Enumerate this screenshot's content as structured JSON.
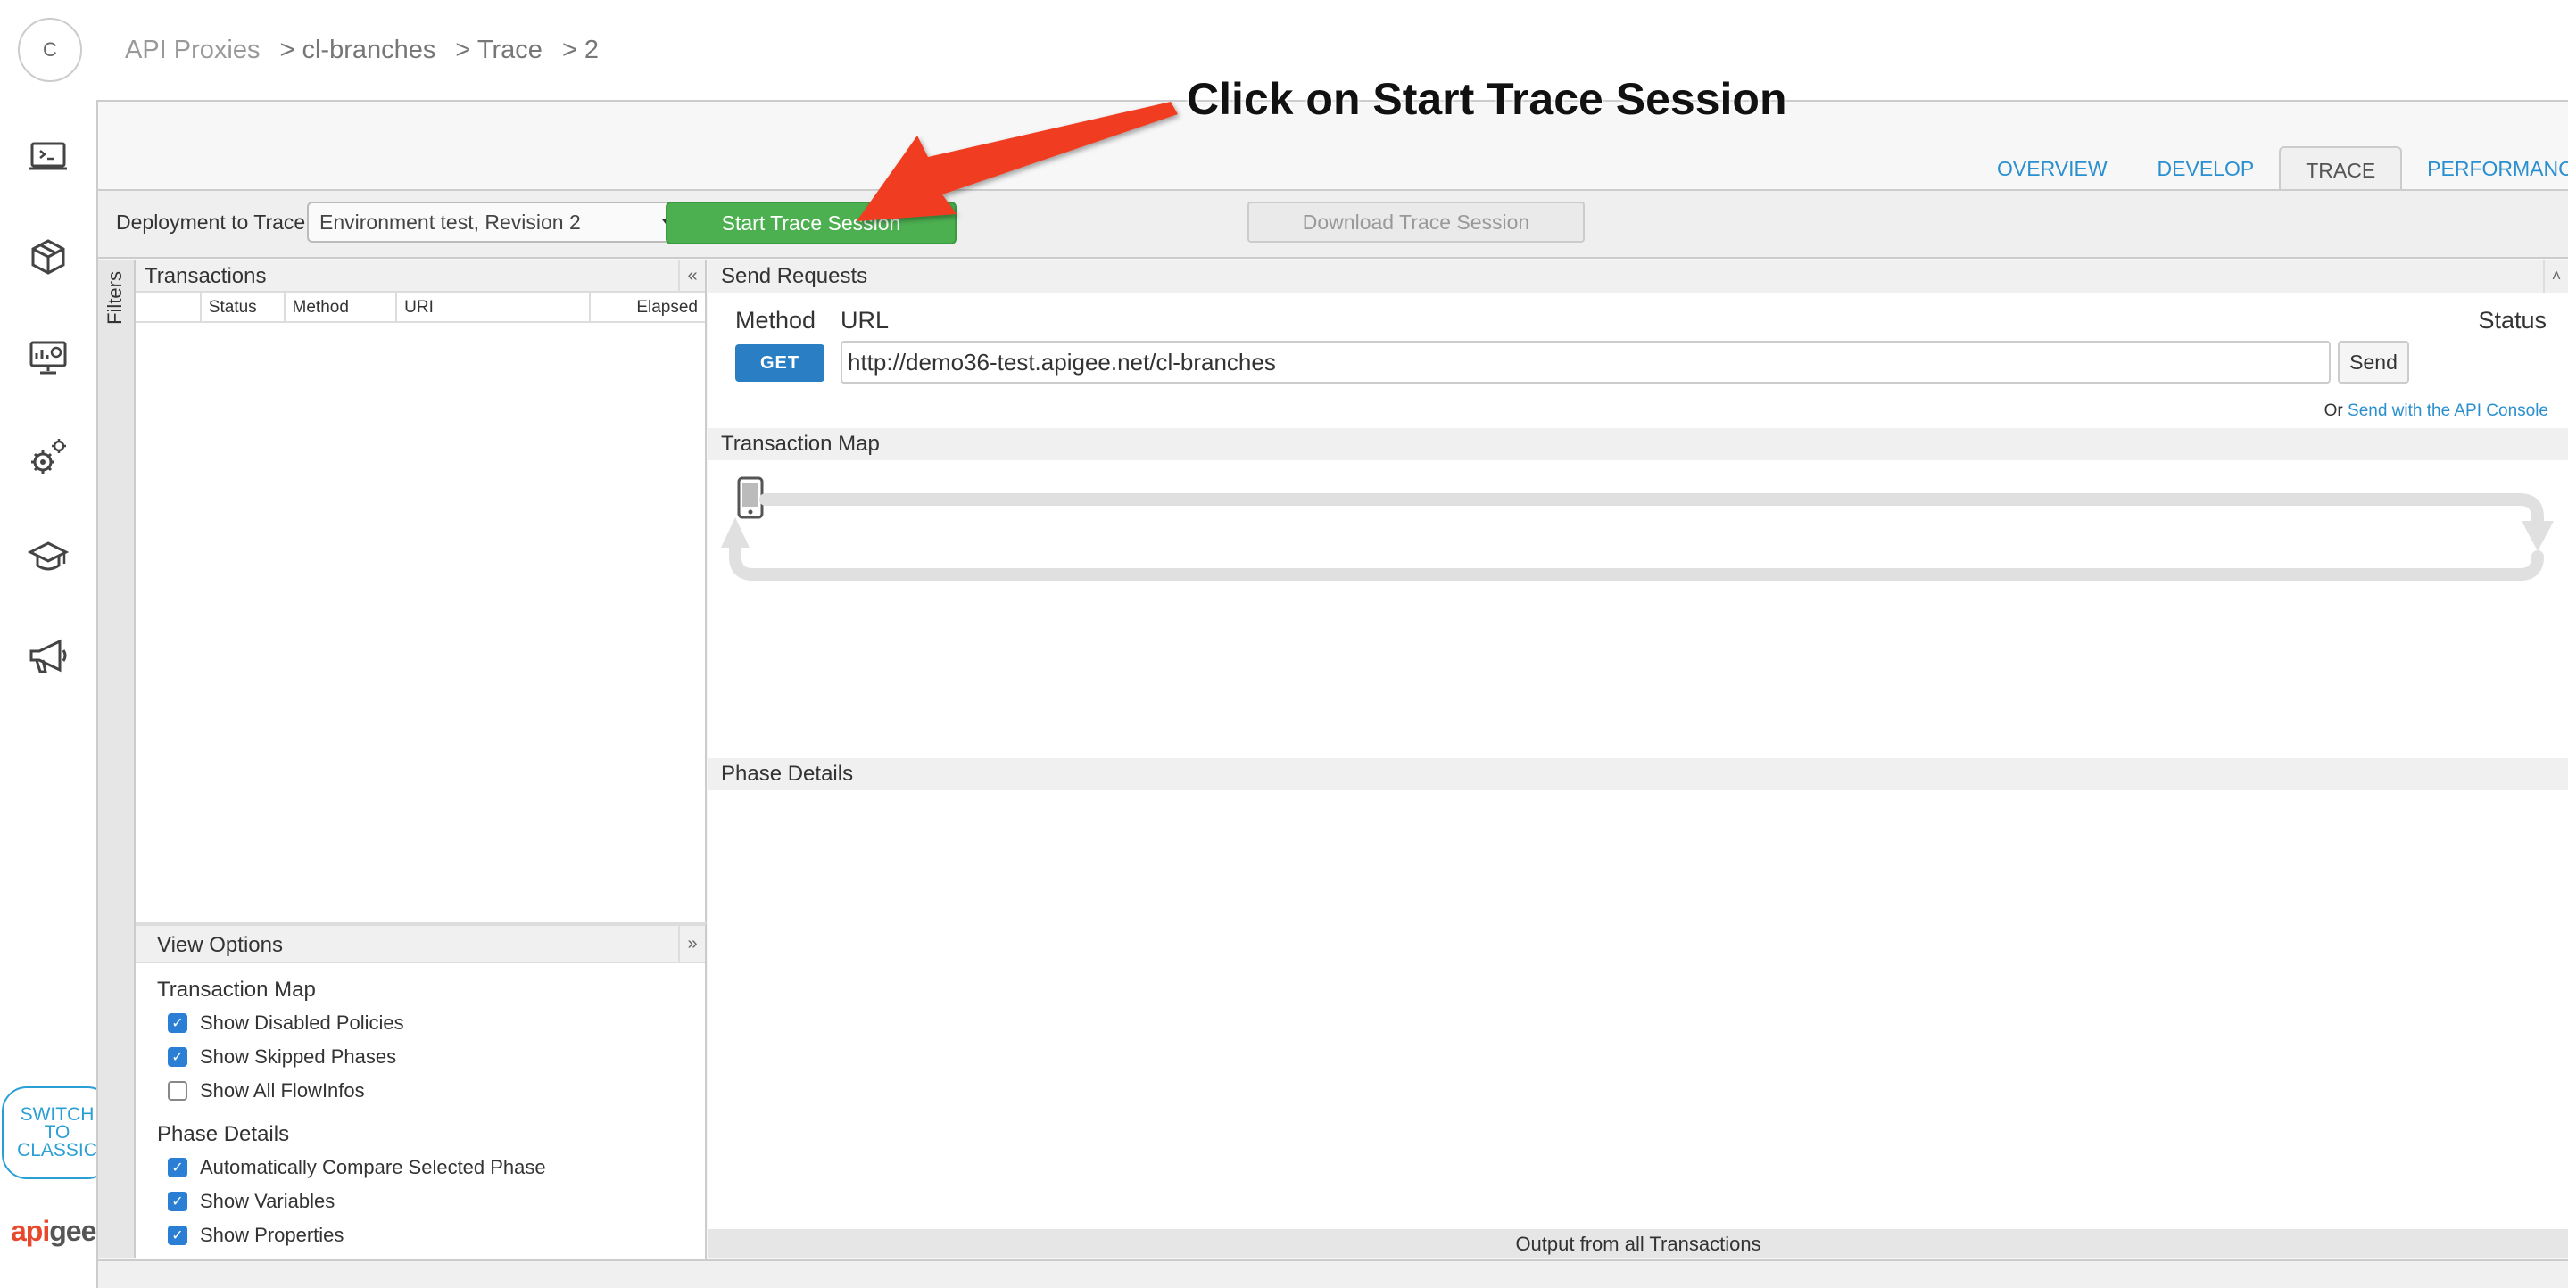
{
  "user": {
    "avatar_initial": "C"
  },
  "breadcrumb": {
    "items": [
      "API Proxies",
      "> cl-branches",
      "> Trace",
      "> 2"
    ]
  },
  "nav": {
    "icons": [
      "terminal-icon",
      "package-icon",
      "dashboard-icon",
      "settings-icon",
      "education-icon",
      "megaphone-icon"
    ],
    "switch_classic": "SWITCH TO CLASSIC",
    "logo": "apigee"
  },
  "annotation": {
    "text": "Click on Start Trace Session",
    "arrow_color": "#f03c20"
  },
  "tabs": [
    {
      "label": "OVERVIEW",
      "active": false
    },
    {
      "label": "DEVELOP",
      "active": false
    },
    {
      "label": "TRACE",
      "active": true
    },
    {
      "label": "PERFORMANCE",
      "active": false
    }
  ],
  "toolbar": {
    "deployment_label": "Deployment to Trace",
    "deployment_value": "Environment test, Revision 2",
    "start_trace": "Start Trace Session",
    "download_trace": "Download Trace Session"
  },
  "filters": {
    "label": "Filters"
  },
  "transactions": {
    "title": "Transactions",
    "columns": [
      "",
      "Status",
      "Method",
      "URI",
      "Elapsed"
    ]
  },
  "view_options": {
    "title": "View Options",
    "transaction_map": {
      "title": "Transaction Map",
      "options": [
        {
          "label": "Show Disabled Policies",
          "checked": true
        },
        {
          "label": "Show Skipped Phases",
          "checked": true
        },
        {
          "label": "Show All FlowInfos",
          "checked": false
        }
      ]
    },
    "phase_details": {
      "title": "Phase Details",
      "options": [
        {
          "label": "Automatically Compare Selected Phase",
          "checked": true
        },
        {
          "label": "Show Variables",
          "checked": true
        },
        {
          "label": "Show Properties",
          "checked": true
        }
      ]
    }
  },
  "send_requests": {
    "title": "Send Requests",
    "method_label": "Method",
    "url_label": "URL",
    "status_label": "Status",
    "method": "GET",
    "url": "http://demo36-test.apigee.net/cl-branches",
    "send": "Send",
    "console_prefix": "Or",
    "console_link": "Send with the API Console"
  },
  "transaction_map": {
    "title": "Transaction Map"
  },
  "phase_details": {
    "title": "Phase Details"
  },
  "output": {
    "label": "Output from all Transactions"
  },
  "colors": {
    "accent": "#2a8fcf",
    "start_green": "#4cb050",
    "get_blue": "#2a7fc4",
    "apigee_red": "#e8492c"
  }
}
